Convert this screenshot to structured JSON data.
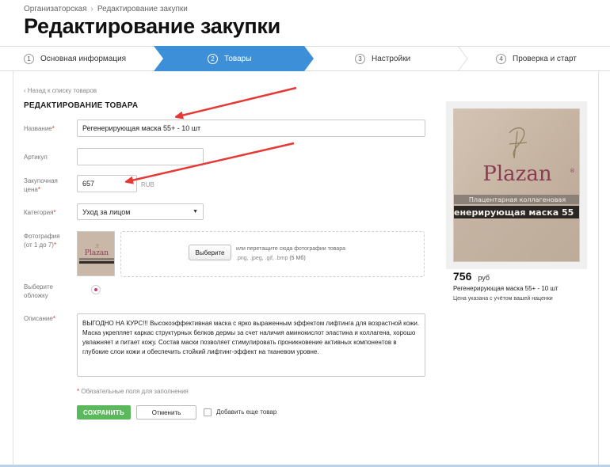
{
  "breadcrumb": {
    "items": [
      "Организаторская",
      "Редактирование закупки"
    ],
    "separator": "›"
  },
  "page": {
    "title": "Редактирование закупки"
  },
  "steps": [
    {
      "num": "1",
      "label": "Основная информация"
    },
    {
      "num": "2",
      "label": "Товары",
      "active": true
    },
    {
      "num": "3",
      "label": "Настройки"
    },
    {
      "num": "4",
      "label": "Проверка и старт"
    }
  ],
  "back_link": "‹ Назад к списку товаров",
  "section_title": "РЕДАКТИРОВАНИЕ ТОВАРА",
  "form": {
    "required_mark": "*",
    "name": {
      "label": "Название",
      "value": "Регенерирующая маска 55+ - 10 шт"
    },
    "article": {
      "label": "Артикул",
      "value": ""
    },
    "price": {
      "label_line1": "Закупочная",
      "label_line2": "цена",
      "value": "657",
      "unit": "RUB"
    },
    "category": {
      "label": "Категория",
      "value": "Уход за лицом",
      "caret": "▼"
    },
    "photos": {
      "label_line1": "Фотография",
      "label_line2": "(от 1 до 7)",
      "choose_label": "Выберите",
      "drop_text": "или перетащите сюда фотографии товара",
      "formats": ".png, .jpeg, .gif, .bmp",
      "max_size": "(5 Мб)"
    },
    "cover": {
      "label_line1": "Выберите",
      "label_line2": "обложку"
    },
    "description": {
      "label": "Описание",
      "value": "ВЫГОДНО НА КУРС!!! Высокоэффективная маска с ярко выраженным эффектом лифтинга для возрастной кожи. Маска укрепляет каркас структурных белков дермы за счет наличия аминокислот эластина и коллагена, хорошо увлажняет и питает кожу. Состав маски позволяет стимулировать проникновение активных компонентов в глубокие слои кожи и обеспечить стойкий лифтинг-эффект на тканевом уровне."
    },
    "required_note": "Обязательные поля для заполнения",
    "save_label": "СОХРАНИТЬ",
    "cancel_label": "Отменить",
    "add_more_label": "Добавить еще товар"
  },
  "product_image": {
    "brand": "Plazan",
    "reg": "®",
    "line1": "Плацентарная коллагеновая",
    "line2": "енерирующая маска 55"
  },
  "preview": {
    "price": "756",
    "currency": "руб",
    "name": "Регенерирующая маска 55+ - 10 шт",
    "note": "Цена указана с учётом вашей наценки"
  },
  "colors": {
    "accent": "#3d8fd8",
    "save": "#5cb85c",
    "annotation_arrow": "#e53935",
    "radio": "#d03678"
  }
}
